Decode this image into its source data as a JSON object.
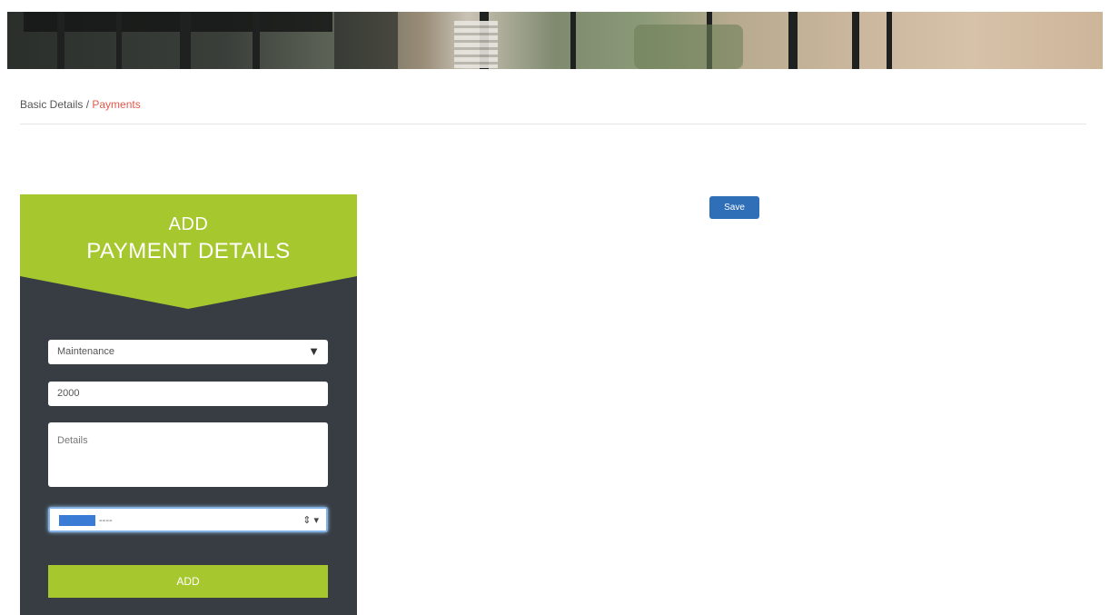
{
  "breadcrumb": {
    "parent": "Basic Details",
    "separator": " / ",
    "current": "Payments"
  },
  "card": {
    "title_line1": "ADD",
    "title_line2": "PAYMENT DETAILS",
    "payment_type": {
      "value": "Maintenance"
    },
    "amount": {
      "value": "2000"
    },
    "details": {
      "placeholder": "Details"
    },
    "date": {
      "value_rest": "----"
    },
    "add_label": "ADD"
  },
  "save_label": "Save",
  "colors": {
    "accent_green": "#a7c72e",
    "card_bg": "#373d43",
    "save_blue": "#2f6fb7",
    "breadcrumb_active": "#e05a4c"
  }
}
